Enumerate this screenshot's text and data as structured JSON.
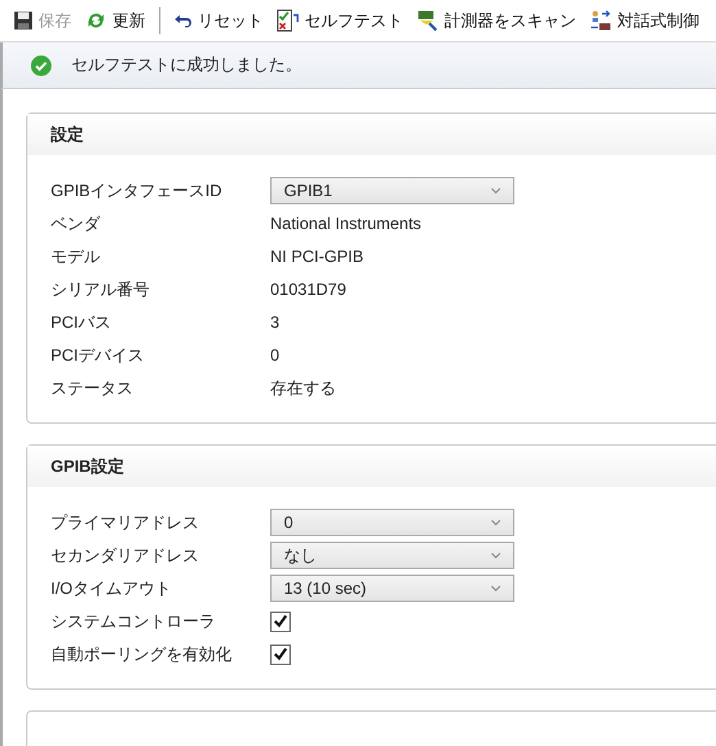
{
  "toolbar": [
    {
      "kind": "save",
      "label": "保存",
      "disabled": true
    },
    {
      "kind": "refresh",
      "label": "更新",
      "disabled": false
    },
    {
      "kind": "separator"
    },
    {
      "kind": "reset",
      "label": "リセット",
      "disabled": false
    },
    {
      "kind": "selftest",
      "label": "セルフテスト",
      "disabled": false
    },
    {
      "kind": "scan",
      "label": "計測器をスキャン",
      "disabled": false
    },
    {
      "kind": "interactive",
      "label": "対話式制御",
      "disabled": false
    }
  ],
  "message": {
    "kind": "success",
    "text": "セルフテストに成功しました。"
  },
  "sections": [
    {
      "title": "設定",
      "rows": [
        {
          "kind": "select",
          "label": "GPIBインタフェースID",
          "value": "GPIB1"
        },
        {
          "kind": "text",
          "label": "ベンダ",
          "value": "National Instruments"
        },
        {
          "kind": "text",
          "label": "モデル",
          "value": "NI PCI-GPIB"
        },
        {
          "kind": "text",
          "label": "シリアル番号",
          "value": "01031D79"
        },
        {
          "kind": "text",
          "label": "PCIバス",
          "value": "3"
        },
        {
          "kind": "text",
          "label": "PCIデバイス",
          "value": "0"
        },
        {
          "kind": "text",
          "label": "ステータス",
          "value": "存在する"
        }
      ]
    },
    {
      "title": "GPIB設定",
      "rows": [
        {
          "kind": "select",
          "label": "プライマリアドレス",
          "value": "0"
        },
        {
          "kind": "select",
          "label": "セカンダリアドレス",
          "value": "なし"
        },
        {
          "kind": "select",
          "label": "I/Oタイムアウト",
          "value": "13 (10 sec)"
        },
        {
          "kind": "checkbox",
          "label": "システムコントローラ",
          "checked": true
        },
        {
          "kind": "checkbox",
          "label": "自動ポーリングを有効化",
          "checked": true
        }
      ]
    }
  ]
}
